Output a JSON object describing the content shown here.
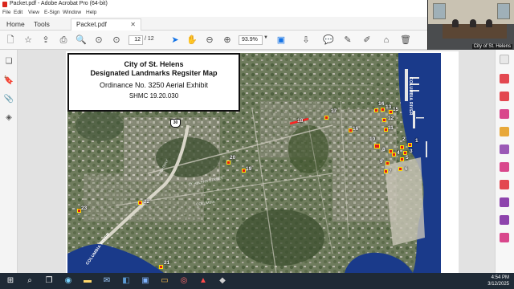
{
  "window": {
    "title": "Packet.pdf - Adobe Acrobat Pro (64-bit)"
  },
  "menu": [
    "File",
    "Edit",
    "View",
    "E-Sign",
    "Window",
    "Help"
  ],
  "tabs": {
    "home": "Home",
    "tools": "Tools",
    "document": "Packet.pdf"
  },
  "toolbar": {
    "page_current": "12",
    "page_total": "/ 12",
    "zoom": "93.9%"
  },
  "map": {
    "title_line1": "City of St. Helens",
    "title_line2": "Designated Landmarks Regsiter Map",
    "subtitle": "Ordinance No. 3250 Aerial Exhibit",
    "code": "SHMC 19.20.030",
    "river_labels": [
      "COLUMBIA RIVER",
      "COLUMBIA RIVER"
    ],
    "road_labels": [
      "HIGHWAY",
      "ST HELENS STREET",
      "COLUMBIA"
    ],
    "route_shield": "30",
    "markers": [
      "1",
      "2",
      "3",
      "4",
      "5",
      "6",
      "7",
      "8",
      "9",
      "10",
      "11",
      "12",
      "13",
      "14",
      "15",
      "16",
      "17",
      "18",
      "19",
      "20",
      "21",
      "22",
      "23"
    ]
  },
  "webcam": {
    "caption": "City of St. Helens"
  },
  "taskbar": {
    "time": "4:54 PM",
    "date": "3/12/2025"
  }
}
